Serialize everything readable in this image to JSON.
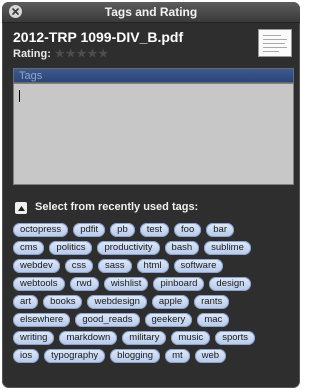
{
  "window": {
    "title": "Tags and Rating"
  },
  "file": {
    "name": "2012-TRP 1099-DIV_B.pdf"
  },
  "rating": {
    "label": "Rating:",
    "stars": 5,
    "value": 0
  },
  "tags_field": {
    "header": "Tags",
    "value": ""
  },
  "recent": {
    "label": "Select from recently used tags:",
    "expanded": true
  },
  "tag_rows": [
    [
      "octopress",
      "pdfit",
      "pb",
      "test",
      "foo",
      "bar"
    ],
    [
      "cms",
      "politics",
      "productivity",
      "bash",
      "sublime"
    ],
    [
      "webdev",
      "css",
      "sass",
      "html",
      "software"
    ],
    [
      "webtools",
      "rwd",
      "wishlist",
      "pinboard",
      "design"
    ],
    [
      "art",
      "books",
      "webdesign",
      "apple",
      "rants"
    ],
    [
      "elsewhere",
      "good_reads",
      "geekery",
      "mac"
    ],
    [
      "writing",
      "markdown",
      "military",
      "music",
      "sports"
    ],
    [
      "ios",
      "typography",
      "blogging",
      "mt",
      "web"
    ]
  ],
  "colors": {
    "panel": "#1e1e1e",
    "tag_fill": "#c6d6f2",
    "tags_header": "#2b4577"
  }
}
